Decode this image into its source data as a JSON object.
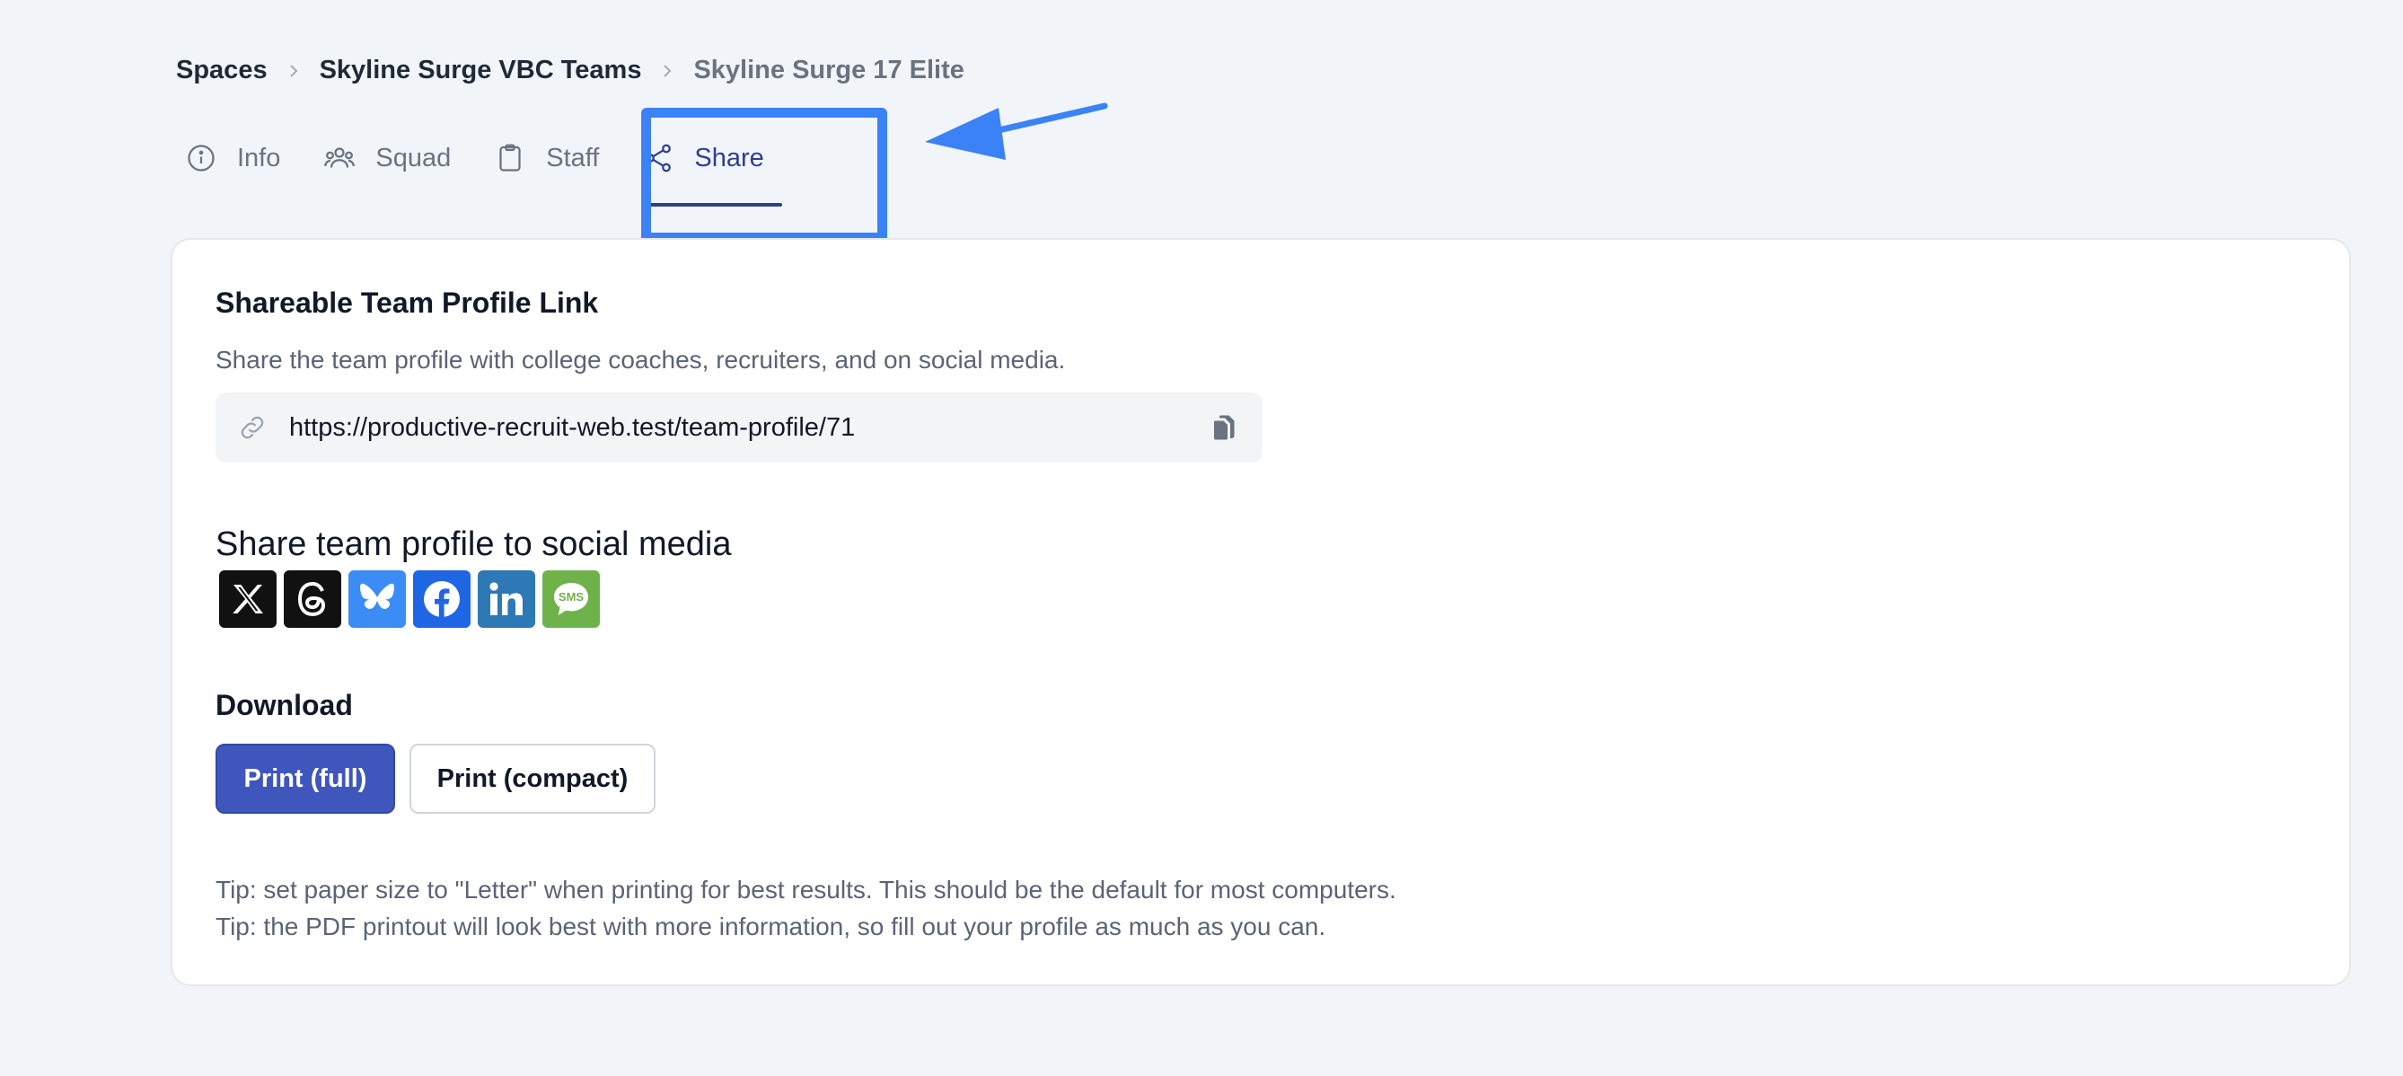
{
  "breadcrumb": {
    "items": [
      "Spaces",
      "Skyline Surge VBC Teams"
    ],
    "current": "Skyline Surge 17 Elite"
  },
  "tabs": [
    {
      "label": "Info",
      "icon": "info-icon"
    },
    {
      "label": "Squad",
      "icon": "users-icon"
    },
    {
      "label": "Staff",
      "icon": "clipboard-icon"
    },
    {
      "label": "Share",
      "icon": "share-icon",
      "active": true
    }
  ],
  "share_link": {
    "title": "Shareable Team Profile Link",
    "description": "Share the team profile with college coaches, recruiters, and on social media.",
    "url": "https://productive-recruit-web.test/team-profile/71"
  },
  "social": {
    "title": "Share team profile to social media",
    "networks": [
      {
        "name": "x",
        "icon": "x-icon",
        "color": "#111111"
      },
      {
        "name": "threads",
        "icon": "threads-icon",
        "color": "#111111"
      },
      {
        "name": "bluesky",
        "icon": "bluesky-icon",
        "color": "#3b8cf5"
      },
      {
        "name": "facebook",
        "icon": "facebook-icon",
        "color": "#1f66e5"
      },
      {
        "name": "linkedin",
        "icon": "linkedin-icon",
        "color": "#2e78b5"
      },
      {
        "name": "sms",
        "icon": "sms-icon",
        "color": "#6fb24a",
        "label": "SMS"
      }
    ]
  },
  "download": {
    "title": "Download",
    "print_full": "Print (full)",
    "print_compact": "Print (compact)"
  },
  "tips": [
    "Tip: set paper size to \"Letter\" when printing for best results. This should be the default for most computers.",
    "Tip: the PDF printout will look best with more information, so fill out your profile as much as you can."
  ],
  "colors": {
    "accent": "#2f3e8f",
    "primary_button": "#3f56bd",
    "highlight": "#3b82f6"
  }
}
